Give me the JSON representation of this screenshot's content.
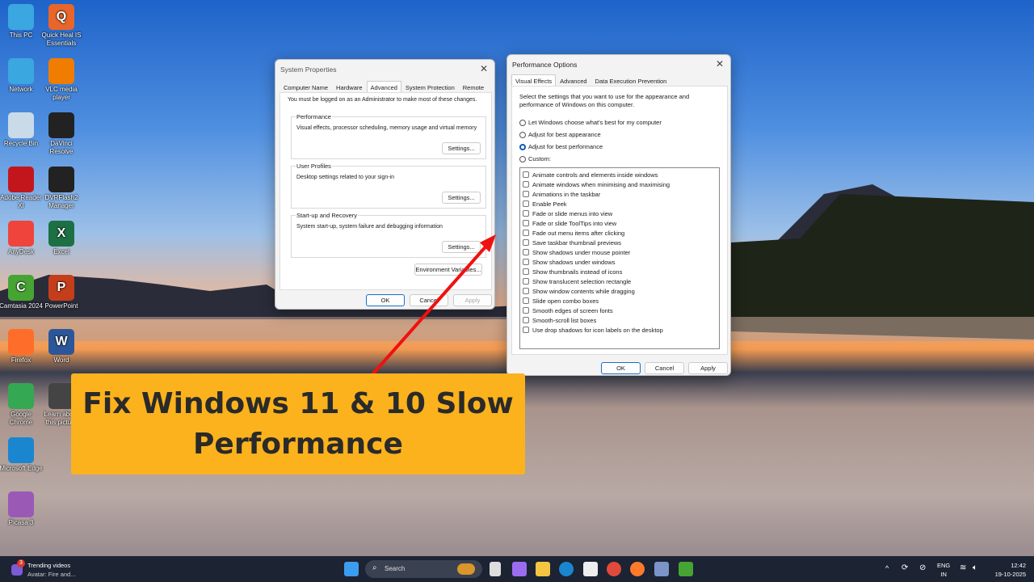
{
  "desktop_icons": [
    {
      "label": "This PC",
      "color": "#3aa7e0"
    },
    {
      "label": "Quick Heal IS Essentials",
      "color": "#e8662a",
      "glyph": "Q"
    },
    {
      "label": "Network",
      "color": "#3aa7e0"
    },
    {
      "label": "VLC media player",
      "color": "#f07c00"
    },
    {
      "label": "Recycle Bin",
      "color": "#c9dbe8"
    },
    {
      "label": "DaVinci Resolve",
      "color": "#222"
    },
    {
      "label": "Adobe Reader XI",
      "color": "#c3161c"
    },
    {
      "label": "DVRFlash2 Manager",
      "color": "#222"
    },
    {
      "label": "AnyDesk",
      "color": "#ef443b"
    },
    {
      "label": "Excel",
      "color": "#1d7044",
      "glyph": "X"
    },
    {
      "label": "Camtasia 2024",
      "color": "#46a433",
      "glyph": "C"
    },
    {
      "label": "PowerPoint",
      "color": "#c43e1c",
      "glyph": "P"
    },
    {
      "label": "Firefox",
      "color": "#ff6d2b"
    },
    {
      "label": "Word",
      "color": "#2b579a",
      "glyph": "W"
    },
    {
      "label": "Google Chrome",
      "color": "#34a853"
    },
    {
      "label": "Learn about this picture",
      "color": "#444"
    },
    {
      "label": "Microsoft Edge",
      "color": "#1a86d0"
    },
    {
      "label": "Picasa 3",
      "color": "#9b59b6"
    }
  ],
  "sysprops": {
    "title": "System Properties",
    "tabs": [
      "Computer Name",
      "Hardware",
      "Advanced",
      "System Protection",
      "Remote"
    ],
    "notice": "You must be logged on as an Administrator to make most of these changes.",
    "groups": [
      {
        "label": "Performance",
        "desc": "Visual effects, processor scheduling, memory usage and virtual memory",
        "button": "Settings..."
      },
      {
        "label": "User Profiles",
        "desc": "Desktop settings related to your sign-in",
        "button": "Settings..."
      },
      {
        "label": "Start-up and Recovery",
        "desc": "System start-up, system failure and debugging information",
        "button": "Settings..."
      }
    ],
    "env_button": "Environment Variables...",
    "ok": "OK",
    "cancel": "Cancel",
    "apply": "Apply"
  },
  "perf": {
    "title": "Performance Options",
    "tabs": [
      "Visual Effects",
      "Advanced",
      "Data Execution Prevention"
    ],
    "intro": "Select the settings that you want to use for the appearance and performance of Windows on this computer.",
    "radios": [
      "Let Windows choose what's best for my computer",
      "Adjust for best appearance",
      "Adjust for best performance",
      "Custom:"
    ],
    "selected_radio": 2,
    "checkboxes": [
      "Animate controls and elements inside windows",
      "Animate windows when minimising and maximising",
      "Animations in the taskbar",
      "Enable Peek",
      "Fade or slide menus into view",
      "Fade or slide ToolTips into view",
      "Fade out menu items after clicking",
      "Save taskbar thumbnail previews",
      "Show shadows under mouse pointer",
      "Show shadows under windows",
      "Show thumbnails instead of icons",
      "Show translucent selection rectangle",
      "Show window contents while dragging",
      "Slide open combo boxes",
      "Smooth edges of screen fonts",
      "Smooth-scroll list boxes",
      "Use drop shadows for icon labels on the desktop"
    ],
    "ok": "OK",
    "cancel": "Cancel",
    "apply": "Apply"
  },
  "banner": {
    "line1": "Fix Windows 11 & 10 Slow",
    "line2": "Performance",
    "color": "#fbb21c"
  },
  "taskbar": {
    "widget_title": "Trending videos",
    "widget_sub": "Avatar: Fire and...",
    "widget_badge": "3",
    "search": "Search",
    "lang": "ENG",
    "region": "IN",
    "time": "12:42",
    "date": "19-10-2025"
  }
}
